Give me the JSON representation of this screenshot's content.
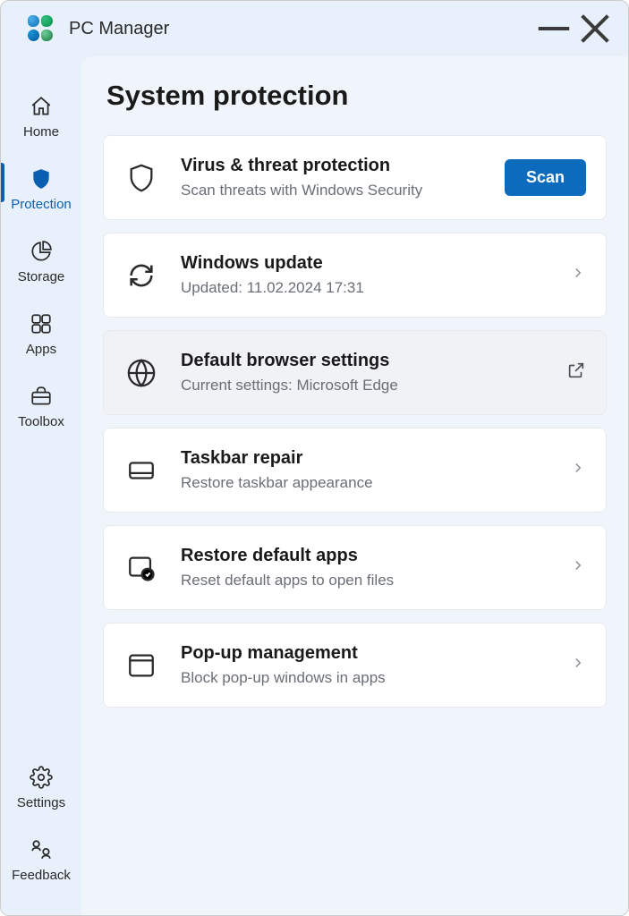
{
  "app": {
    "title": "PC Manager"
  },
  "sidebar": {
    "items": [
      {
        "label": "Home"
      },
      {
        "label": "Protection"
      },
      {
        "label": "Storage"
      },
      {
        "label": "Apps"
      },
      {
        "label": "Toolbox"
      }
    ],
    "bottom": [
      {
        "label": "Settings"
      },
      {
        "label": "Feedback"
      }
    ]
  },
  "page": {
    "title": "System protection",
    "cards": {
      "virus": {
        "title": "Virus & threat protection",
        "sub": "Scan threats with Windows Security",
        "button": "Scan"
      },
      "update": {
        "title": "Windows update",
        "sub": "Updated: 11.02.2024 17:31"
      },
      "browser": {
        "title": "Default browser settings",
        "sub": "Current settings: Microsoft Edge"
      },
      "taskbar": {
        "title": "Taskbar repair",
        "sub": "Restore taskbar appearance"
      },
      "restore": {
        "title": "Restore default apps",
        "sub": "Reset default apps to open files"
      },
      "popup": {
        "title": "Pop-up management",
        "sub": "Block pop-up windows in apps"
      }
    }
  }
}
